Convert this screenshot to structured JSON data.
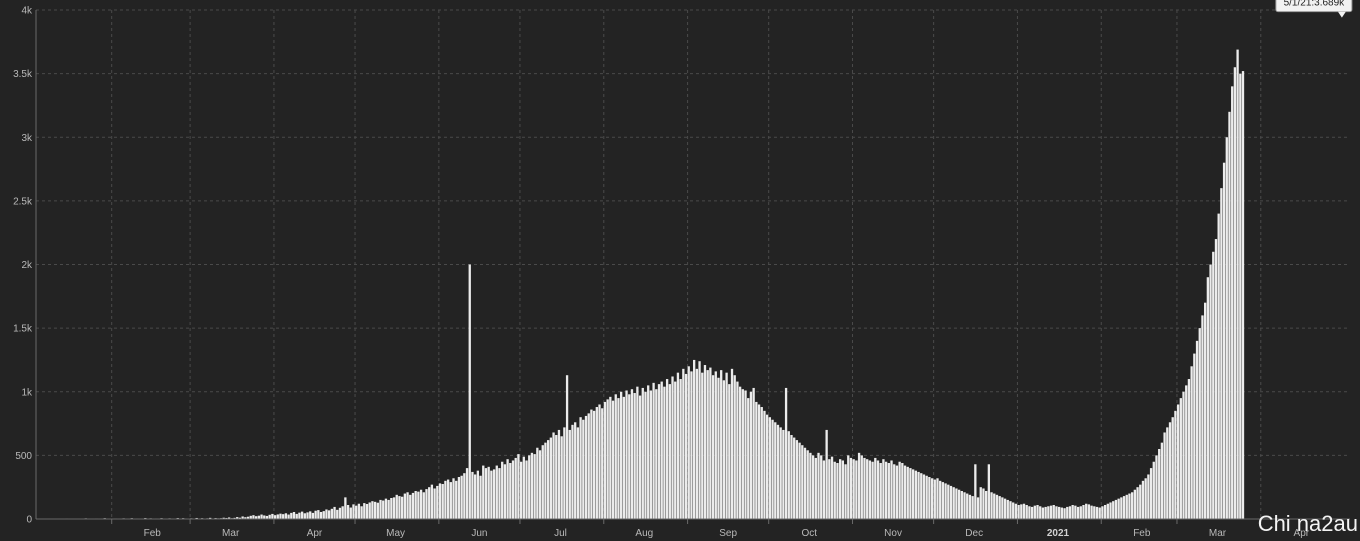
{
  "chart_data": {
    "type": "bar",
    "title": "",
    "xlabel": "",
    "ylabel": "",
    "ylim": [
      0,
      4000
    ],
    "grid": true,
    "y_ticks": [
      {
        "value": 0,
        "label": "0"
      },
      {
        "value": 500,
        "label": "500"
      },
      {
        "value": 1000,
        "label": "1k"
      },
      {
        "value": 1500,
        "label": "1.5k"
      },
      {
        "value": 2000,
        "label": "2k"
      },
      {
        "value": 2500,
        "label": "2.5k"
      },
      {
        "value": 3000,
        "label": "3k"
      },
      {
        "value": 3500,
        "label": "3.5k"
      },
      {
        "value": 4000,
        "label": "4k"
      }
    ],
    "x_ticks": [
      {
        "date": "2020-02-01",
        "label": "Feb",
        "bold": false
      },
      {
        "date": "2020-03-01",
        "label": "Mar",
        "bold": false
      },
      {
        "date": "2020-04-01",
        "label": "Apr",
        "bold": false
      },
      {
        "date": "2020-05-01",
        "label": "May",
        "bold": false
      },
      {
        "date": "2020-06-01",
        "label": "Jun",
        "bold": false
      },
      {
        "date": "2020-07-01",
        "label": "Jul",
        "bold": false
      },
      {
        "date": "2020-08-01",
        "label": "Aug",
        "bold": false
      },
      {
        "date": "2020-09-01",
        "label": "Sep",
        "bold": false
      },
      {
        "date": "2020-10-01",
        "label": "Oct",
        "bold": false
      },
      {
        "date": "2020-11-01",
        "label": "Nov",
        "bold": false
      },
      {
        "date": "2020-12-01",
        "label": "Dec",
        "bold": false
      },
      {
        "date": "2021-01-01",
        "label": "2021",
        "bold": true
      },
      {
        "date": "2021-02-01",
        "label": "Feb",
        "bold": false
      },
      {
        "date": "2021-03-01",
        "label": "Mar",
        "bold": false
      },
      {
        "date": "2021-04-01",
        "label": "Apr",
        "bold": false
      }
    ],
    "x_range": [
      "2020-01-04",
      "2021-05-04"
    ],
    "series": [
      {
        "x_start": "2020-01-04",
        "x_step_days": 1,
        "values": [
          0,
          1,
          0,
          2,
          1,
          0,
          3,
          1,
          2,
          0,
          1,
          4,
          2,
          1,
          3,
          0,
          2,
          1,
          5,
          2,
          3,
          1,
          4,
          0,
          2,
          6,
          3,
          1,
          2,
          4,
          3,
          2,
          5,
          1,
          3,
          6,
          2,
          4,
          1,
          3,
          7,
          2,
          5,
          3,
          4,
          2,
          6,
          3,
          1,
          5,
          4,
          2,
          7,
          3,
          6,
          4,
          2,
          5,
          3,
          8,
          4,
          6,
          3,
          5,
          9,
          4,
          7,
          5,
          6,
          10,
          8,
          12,
          6,
          9,
          15,
          10,
          20,
          14,
          18,
          25,
          30,
          22,
          26,
          35,
          28,
          24,
          33,
          40,
          30,
          36,
          42,
          38,
          45,
          35,
          48,
          55,
          40,
          50,
          58,
          45,
          52,
          60,
          48,
          65,
          70,
          55,
          62,
          75,
          68,
          80,
          95,
          72,
          88,
          100,
          170,
          110,
          90,
          115,
          105,
          120,
          100,
          125,
          118,
          130,
          140,
          135,
          128,
          150,
          145,
          160,
          150,
          165,
          170,
          190,
          180,
          175,
          200,
          210,
          190,
          205,
          220,
          215,
          230,
          210,
          235,
          250,
          270,
          240,
          260,
          280,
          275,
          300,
          310,
          290,
          320,
          300,
          330,
          340,
          360,
          400,
          2000,
          370,
          350,
          380,
          340,
          420,
          400,
          410,
          380,
          390,
          420,
          400,
          450,
          430,
          470,
          440,
          460,
          480,
          510,
          450,
          490,
          460,
          500,
          520,
          510,
          560,
          540,
          580,
          600,
          620,
          640,
          680,
          660,
          700,
          650,
          720,
          1130,
          700,
          740,
          760,
          720,
          800,
          780,
          810,
          830,
          860,
          850,
          880,
          900,
          870,
          920,
          940,
          960,
          930,
          980,
          950,
          1000,
          960,
          1010,
          980,
          1020,
          990,
          1040,
          970,
          1030,
          1000,
          1050,
          1010,
          1070,
          1020,
          1060,
          1080,
          1040,
          1100,
          1060,
          1120,
          1080,
          1150,
          1100,
          1180,
          1140,
          1200,
          1160,
          1250,
          1180,
          1240,
          1150,
          1210,
          1170,
          1190,
          1130,
          1160,
          1110,
          1170,
          1090,
          1150,
          1060,
          1180,
          1130,
          1080,
          1040,
          1020,
          1010,
          950,
          1000,
          1030,
          920,
          900,
          880,
          850,
          820,
          800,
          780,
          760,
          740,
          720,
          700,
          1030,
          690,
          660,
          640,
          620,
          600,
          580,
          560,
          540,
          520,
          500,
          480,
          520,
          500,
          460,
          700,
          470,
          490,
          450,
          440,
          470,
          460,
          430,
          500,
          480,
          470,
          460,
          520,
          500,
          480,
          470,
          460,
          450,
          480,
          460,
          440,
          470,
          450,
          440,
          460,
          430,
          420,
          450,
          440,
          420,
          410,
          400,
          390,
          380,
          370,
          360,
          350,
          340,
          330,
          320,
          310,
          320,
          300,
          290,
          280,
          270,
          260,
          250,
          240,
          230,
          220,
          210,
          200,
          190,
          180,
          430,
          170,
          250,
          240,
          220,
          430,
          210,
          200,
          190,
          180,
          170,
          160,
          150,
          140,
          130,
          120,
          110,
          115,
          120,
          110,
          100,
          95,
          105,
          110,
          100,
          90,
          95,
          100,
          105,
          110,
          100,
          95,
          90,
          85,
          95,
          100,
          110,
          105,
          95,
          100,
          110,
          120,
          115,
          105,
          100,
          95,
          90,
          100,
          110,
          120,
          130,
          140,
          150,
          160,
          170,
          180,
          190,
          200,
          210,
          230,
          250,
          270,
          300,
          320,
          350,
          400,
          450,
          500,
          550,
          600,
          680,
          720,
          760,
          800,
          850,
          900,
          950,
          1000,
          1050,
          1100,
          1200,
          1300,
          1400,
          1500,
          1600,
          1700,
          1900,
          2000,
          2100,
          2200,
          2400,
          2600,
          2800,
          3000,
          3200,
          3400,
          3550,
          3689,
          3500,
          3520
        ]
      }
    ],
    "annotation": {
      "text": "5/1/21:3.689k",
      "date": "2021-05-01",
      "value": 3689
    }
  },
  "watermark": {
    "text": "Chi na2au"
  },
  "colors": {
    "background": "#232323",
    "bar": "#ececec",
    "grid": "#4a4a4a",
    "tick_text": "#b9b9b9"
  }
}
